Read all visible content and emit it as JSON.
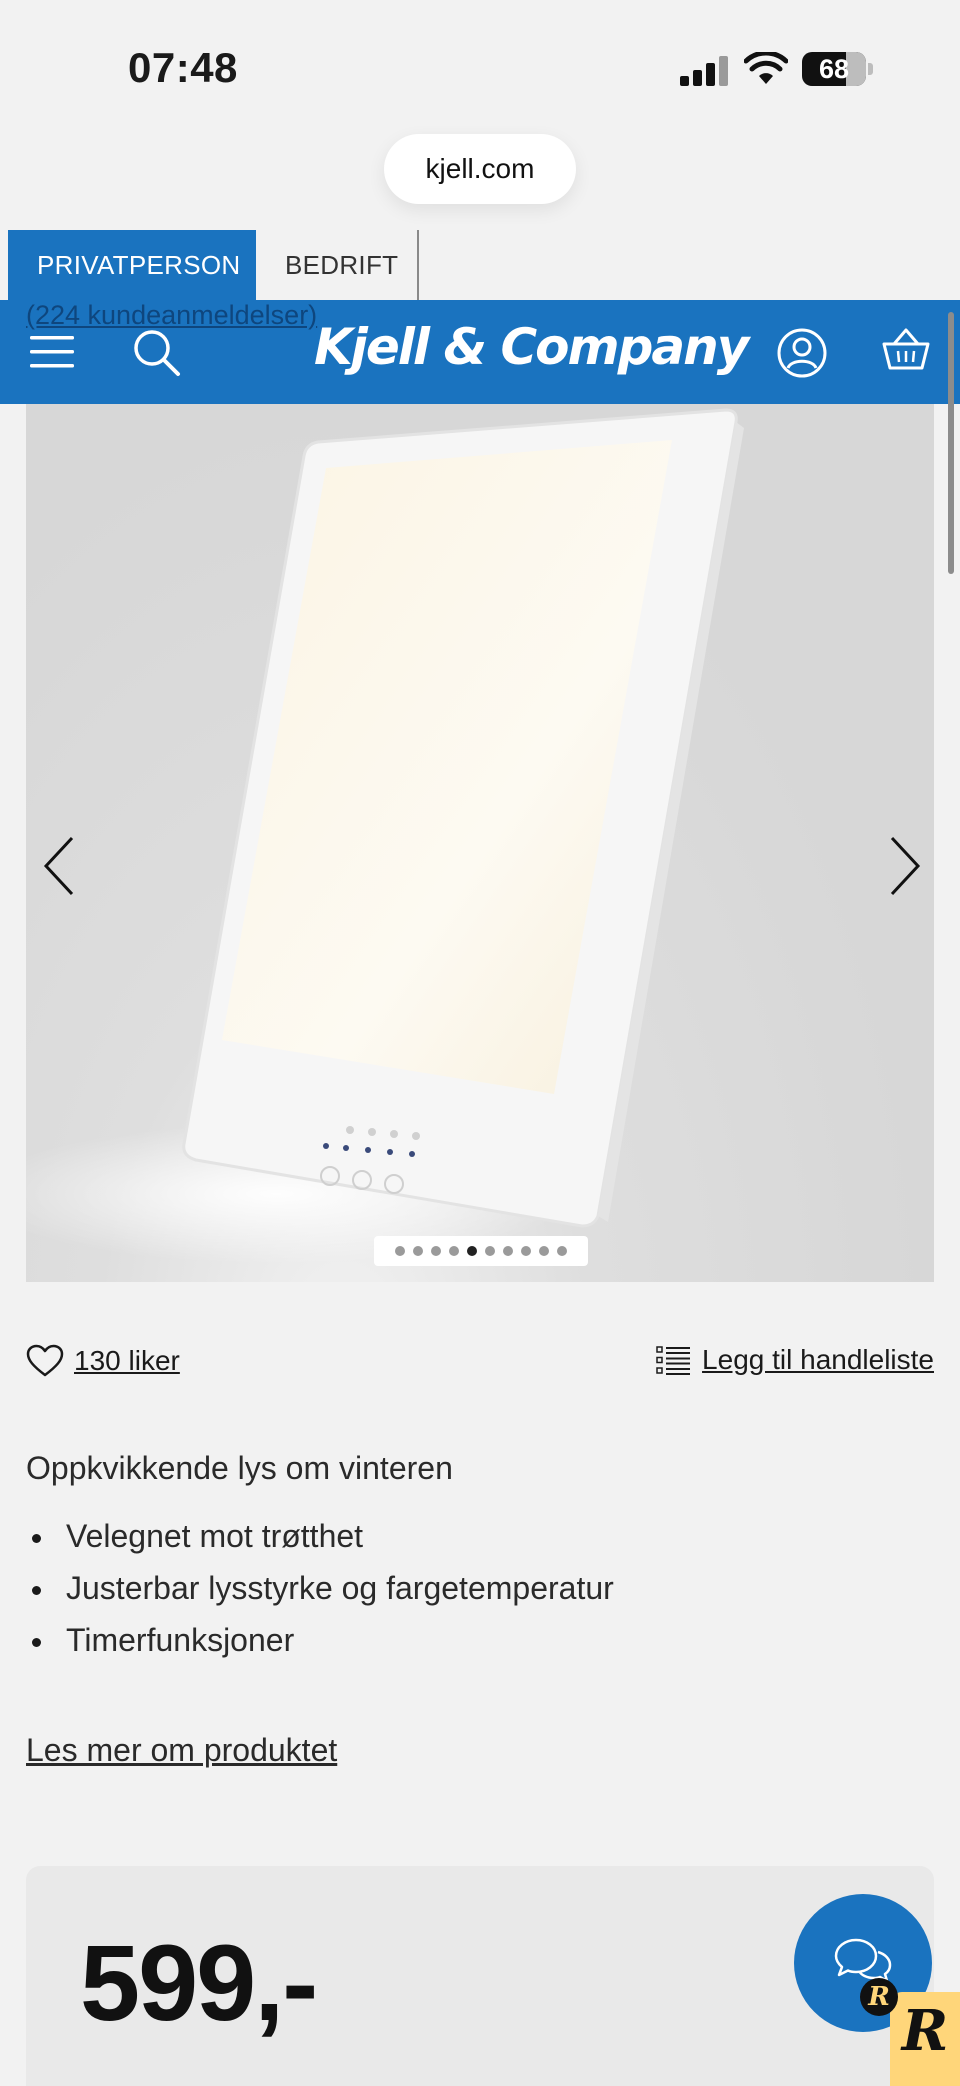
{
  "status_bar": {
    "time": "07:48",
    "battery_percent": "68",
    "battery_level": 0.68,
    "icons": [
      "signal-icon",
      "wifi-icon",
      "battery-icon"
    ]
  },
  "browser": {
    "url": "kjell.com"
  },
  "segment_tabs": [
    {
      "label": "PRIVATPERSON",
      "active": true
    },
    {
      "label": "BEDRIFT",
      "active": false
    }
  ],
  "header": {
    "logo_text": "Kjell & Company",
    "review_link": "(224 kundeanmeldelser)",
    "icons": [
      "menu-icon",
      "search-icon",
      "account-icon",
      "basket-icon"
    ]
  },
  "gallery": {
    "image_alt": "Dagslyslampe",
    "dot_count": 10,
    "active_index": 4,
    "prev_icon": "chevron-left-icon",
    "next_icon": "chevron-right-icon"
  },
  "actions": {
    "likes_label": "130 liker",
    "shopping_list_label": "Legg til handleliste"
  },
  "description": {
    "tagline": "Oppkvikkende lys om vinteren",
    "features": [
      "Velegnet mot trøtthet",
      "Justerbar lysstyrke og fargetemperatur",
      "Timerfunksjoner"
    ],
    "read_more": "Les mer om produktet"
  },
  "price": {
    "value": "599,-"
  },
  "colors": {
    "brand_blue": "#1a73bf",
    "background": "#f2f2f2",
    "badge_yellow": "#ffd67a"
  }
}
